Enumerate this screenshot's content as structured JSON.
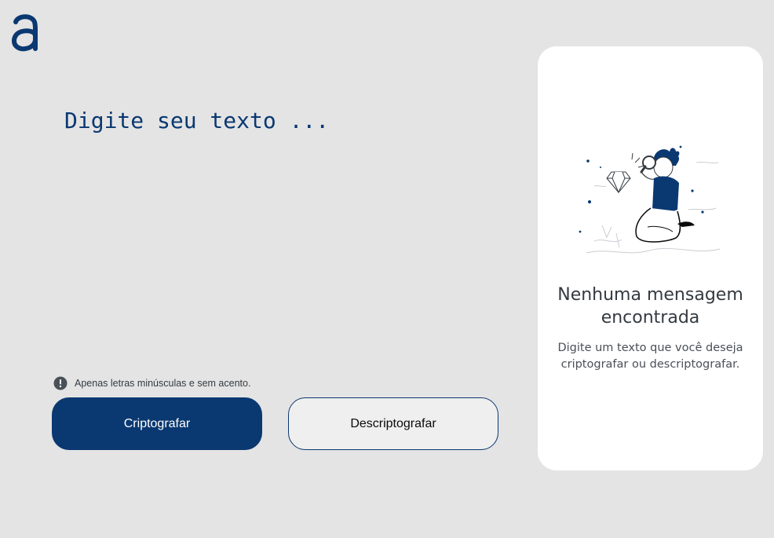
{
  "brand": {
    "logo_icon": "alura-a-logo-icon",
    "color": "#0a3871"
  },
  "input": {
    "placeholder": "Digite seu texto ...",
    "value": ""
  },
  "hint": {
    "icon": "exclamation-circle-icon",
    "text": "Apenas letras minúsculas e sem acento."
  },
  "buttons": {
    "encrypt_label": "Criptografar",
    "decrypt_label": "Descriptografar"
  },
  "output": {
    "illustration_icon": "person-with-magnifier-illustration",
    "title": "Nenhuma mensagem encontrada",
    "message": "Digite um texto que você deseja criptografar ou descriptografar."
  },
  "colors": {
    "background": "#e4e4e4",
    "primary": "#0a3871",
    "panel": "#ffffff"
  }
}
